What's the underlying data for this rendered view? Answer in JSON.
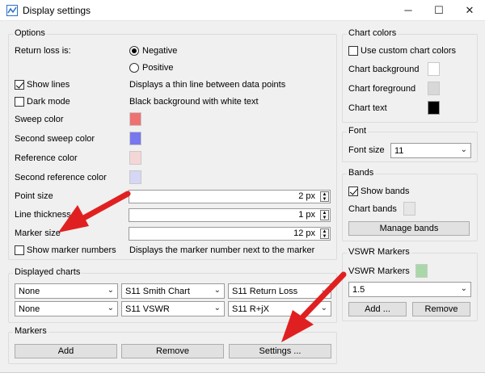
{
  "window": {
    "title": "Display settings",
    "minimize": "─",
    "maximize": "☐",
    "close": "✕"
  },
  "options": {
    "title": "Options",
    "return_loss_label": "Return loss is:",
    "negative": "Negative",
    "positive": "Positive",
    "show_lines": "Show lines",
    "show_lines_desc": "Displays a thin line between data points",
    "dark_mode": "Dark mode",
    "dark_mode_desc": "Black background with white text",
    "sweep_color": "Sweep color",
    "second_sweep_color": "Second sweep color",
    "reference_color": "Reference color",
    "second_reference_color": "Second reference color",
    "point_size_label": "Point size",
    "point_size_value": "2 px",
    "line_thickness_label": "Line thickness",
    "line_thickness_value": "1 px",
    "marker_size_label": "Marker size",
    "marker_size_value": "12 px",
    "show_marker_numbers": "Show marker numbers",
    "show_marker_numbers_desc": "Displays the marker number next to the marker",
    "colors": {
      "sweep": "#ee7272",
      "second_sweep": "#7777ee",
      "reference": "#f5d6d6",
      "second_reference": "#d6d6f5"
    }
  },
  "displayed_charts": {
    "title": "Displayed charts",
    "row1": [
      "None",
      "S11 Smith Chart",
      "S11 Return Loss"
    ],
    "row2": [
      "None",
      "S11 VSWR",
      "S11 R+jX"
    ]
  },
  "markers": {
    "title": "Markers",
    "add": "Add",
    "remove": "Remove",
    "settings": "Settings ..."
  },
  "chart_colors": {
    "title": "Chart colors",
    "use_custom": "Use custom chart colors",
    "background": "Chart background",
    "foreground": "Chart foreground",
    "text": "Chart text",
    "colors": {
      "background": "#ffffff",
      "foreground": "#d8d8d8",
      "text": "#000000"
    }
  },
  "font": {
    "title": "Font",
    "font_size_label": "Font size",
    "font_size_value": "11"
  },
  "bands": {
    "title": "Bands",
    "show_bands": "Show bands",
    "chart_bands": "Chart bands",
    "manage": "Manage bands",
    "color": "#e6e6e6"
  },
  "vswr": {
    "title": "VSWR Markers",
    "label": "VSWR Markers",
    "value": "1.5",
    "add": "Add ...",
    "remove": "Remove",
    "color": "#a8d8a8"
  },
  "accent": {
    "arrow": "#e02020"
  }
}
